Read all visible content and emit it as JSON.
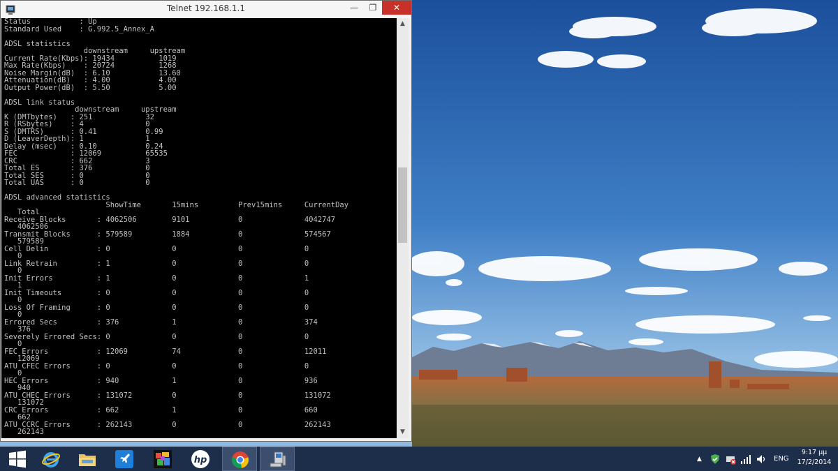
{
  "window": {
    "title": "Telnet 192.168.1.1",
    "controls": {
      "minimize": "—",
      "maximize": "❐",
      "close": "✕"
    }
  },
  "console": {
    "lines": [
      "Status           : Up",
      "Standard Used    : G.992.5_Annex_A",
      "",
      "ADSL statistics",
      "                  downstream     upstream",
      "Current Rate(Kbps): 19434          1019",
      "Max Rate(Kbps)    : 20724          1268",
      "Noise Margin(dB)  : 6.10           13.60",
      "Attenuation(dB)   : 4.00           4.00",
      "Output Power(dB)  : 5.50           5.00",
      "",
      "ADSL link status",
      "                downstream     upstream",
      "K (DMTbytes)   : 251            32",
      "R (RSbytes)    : 4              0",
      "S (DMTRS)      : 0.41           0.99",
      "D (LeaverDepth): 1              1",
      "Delay (msec)   : 0.10           0.24",
      "FEC            : 12069          65535",
      "CRC            : 662            3",
      "Total ES       : 376            0",
      "Total SES      : 0              0",
      "Total UAS      : 0              0",
      "",
      "ADSL advanced statistics",
      "                       ShowTime       15mins         Prev15mins     CurrentDay",
      "   Total",
      "Receive Blocks       : 4062506        9101           0              4042747",
      "   4062506",
      "Transmit Blocks      : 579589         1884           0              574567",
      "   579589",
      "Cell Delin           : 0              0              0              0",
      "   0",
      "Link Retrain         : 1              0              0              0",
      "   0",
      "Init Errors          : 1              0              0              1",
      "   1",
      "Init Timeouts        : 0              0              0              0",
      "   0",
      "Loss Of Framing      : 0              0              0              0",
      "   0",
      "Errored Secs         : 376            1              0              374",
      "   376",
      "Severely Errored Secs: 0              0              0              0",
      "   0",
      "FEC Errors           : 12069          74             0              12011",
      "   12069",
      "ATU CFEC Errors      : 0              0              0              0",
      "   0",
      "HEC Errors           : 940            1              0              936",
      "   940",
      "ATU CHEC Errors      : 131072         0              0              131072",
      "   131072",
      "CRC Errors           : 662            1              0              660",
      "   662",
      "ATU CCRC Errors      : 262143         0              0              262143",
      "   262143"
    ]
  },
  "taskbar": {
    "buttons": [
      {
        "name": "start-button",
        "icon": "windows-logo-icon"
      },
      {
        "name": "internet-explorer-button",
        "icon": "internet-explorer-icon"
      },
      {
        "name": "file-explorer-button",
        "icon": "file-explorer-icon"
      },
      {
        "name": "rocket-app-button",
        "icon": "rocket-icon"
      },
      {
        "name": "photo-app-button",
        "icon": "photo-collage-icon"
      },
      {
        "name": "hp-app-button",
        "icon": "hp-logo-icon"
      },
      {
        "name": "chrome-button",
        "icon": "chrome-icon"
      },
      {
        "name": "telnet-button",
        "icon": "telnet-computer-icon"
      }
    ],
    "tray": {
      "expand": "▲",
      "language": "ENG",
      "time": "9:17 μμ",
      "date": "17/2/2014"
    }
  },
  "colors": {
    "console_bg": "#000000",
    "console_text": "#c0c0c0",
    "taskbar_bg": "#1c2e4a",
    "close_button": "#c7312a"
  }
}
